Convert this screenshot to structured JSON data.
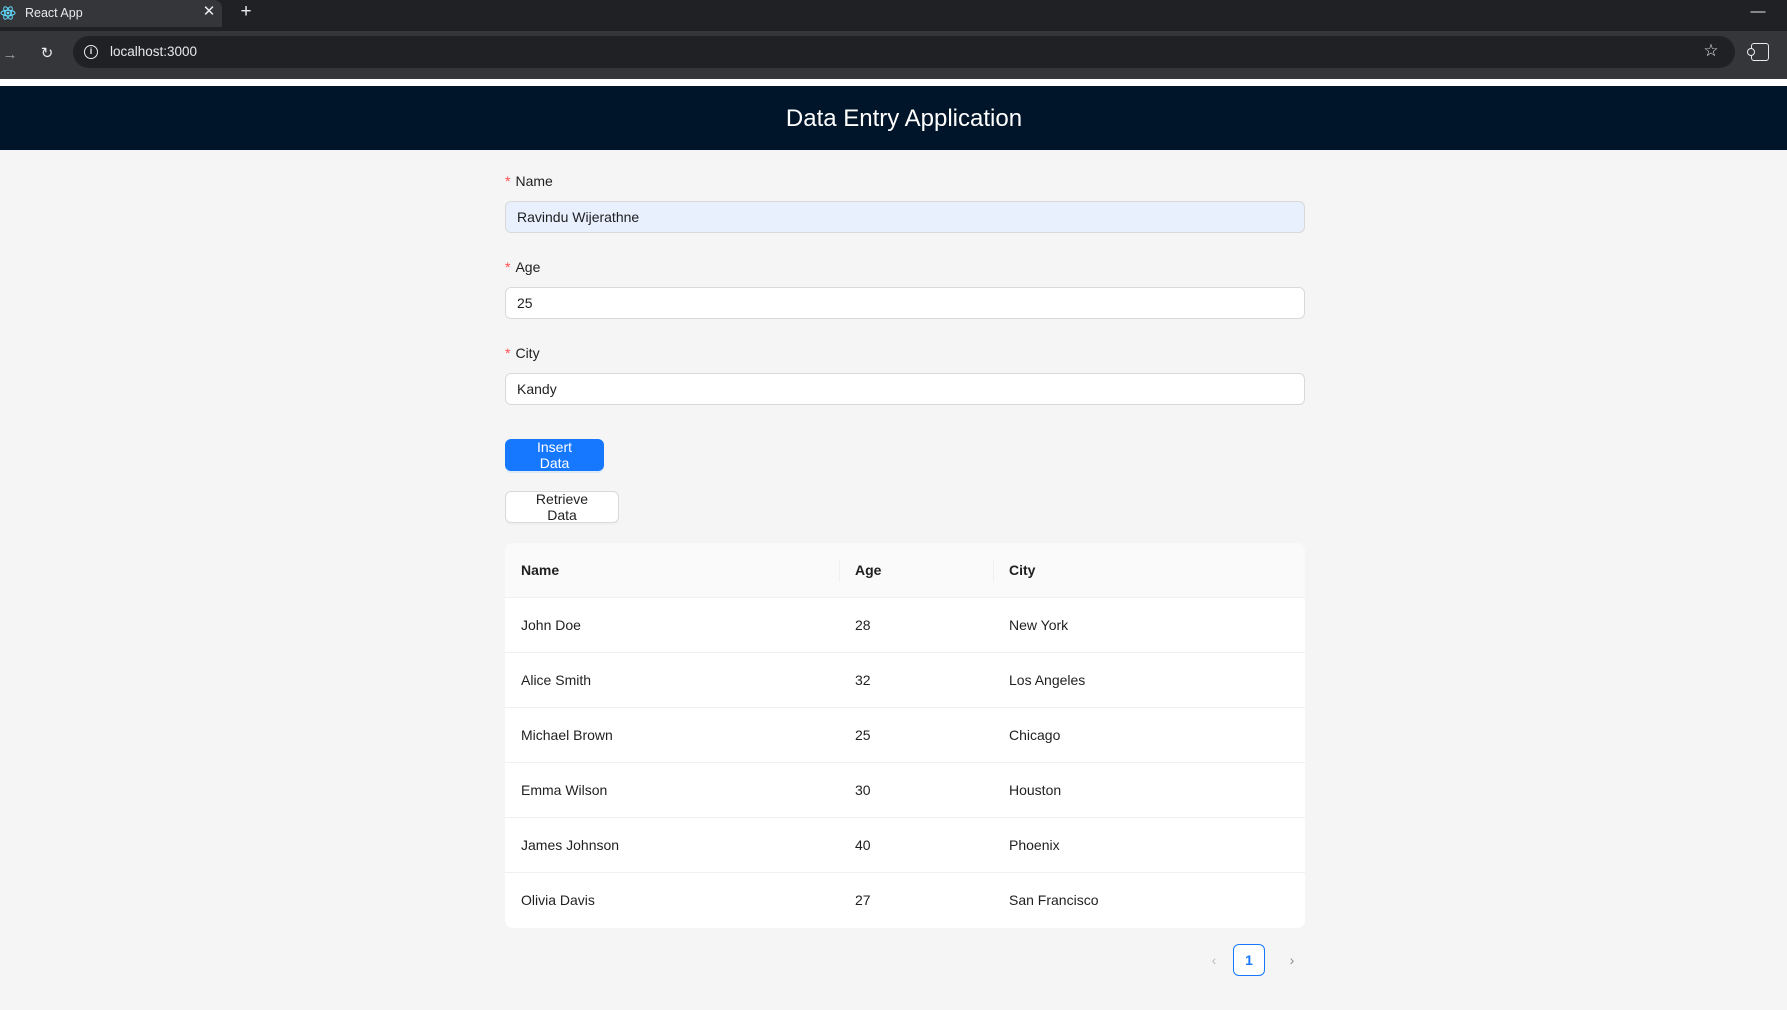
{
  "browser": {
    "tab_title": "React App",
    "close_glyph": "✕",
    "new_tab_glyph": "+",
    "minimize_glyph": "—",
    "forward_glyph": "→",
    "reload_glyph": "↻",
    "info_glyph": "i",
    "url": "localhost:3000",
    "star_glyph": "☆"
  },
  "header": {
    "title": "Data Entry Application"
  },
  "form": {
    "required_mark": "*",
    "name": {
      "label": "Name",
      "value": "Ravindu Wijerathne"
    },
    "age": {
      "label": "Age",
      "value": "25"
    },
    "city": {
      "label": "City",
      "value": "Kandy"
    }
  },
  "buttons": {
    "insert": "Insert Data",
    "retrieve": "Retrieve Data"
  },
  "table": {
    "columns": [
      "Name",
      "Age",
      "City"
    ],
    "rows": [
      [
        "John Doe",
        "28",
        "New York"
      ],
      [
        "Alice Smith",
        "32",
        "Los Angeles"
      ],
      [
        "Michael Brown",
        "25",
        "Chicago"
      ],
      [
        "Emma Wilson",
        "30",
        "Houston"
      ],
      [
        "James Johnson",
        "40",
        "Phoenix"
      ],
      [
        "Olivia Davis",
        "27",
        "San Francisco"
      ]
    ]
  },
  "pagination": {
    "prev_glyph": "‹",
    "next_glyph": "›",
    "current_page": "1"
  },
  "colors": {
    "header_bg": "#001529",
    "primary": "#1677ff",
    "required": "#ff4d4f",
    "autofill_bg": "#e8f0fe"
  }
}
